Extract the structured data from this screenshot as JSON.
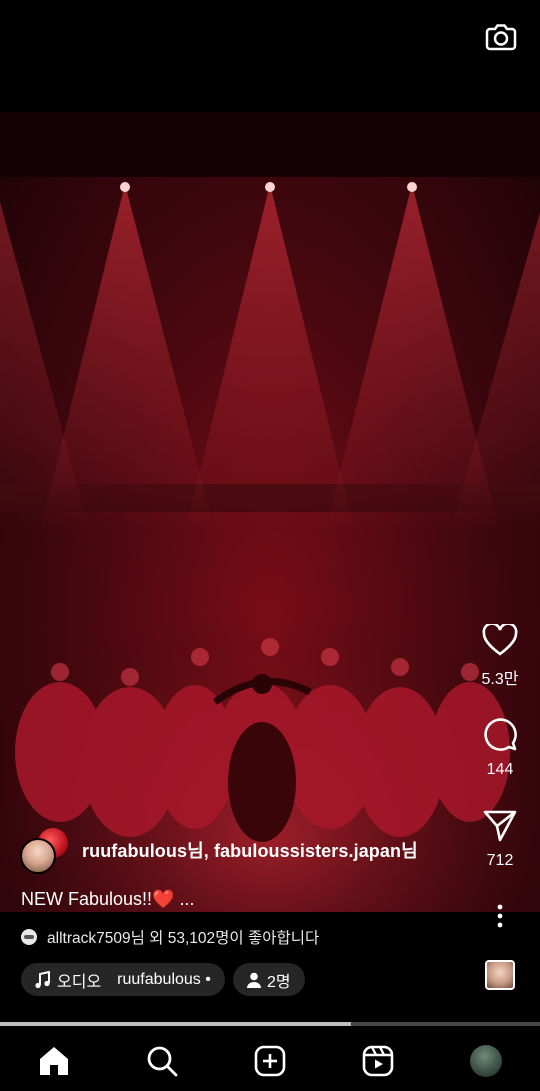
{
  "post": {
    "author_names": "ruufabulous님, fabuloussisters.japan님",
    "caption": "NEW Fabulous!!❤️ ...",
    "likes_text": "alltrack7509님 외 53,102명이 좋아합니다",
    "audio_label": "오디오",
    "audio_author": "ruufabulous •",
    "people_label": "2명"
  },
  "actions": {
    "like_count": "5.3만",
    "comment_count": "144",
    "share_count": "712"
  },
  "video": {
    "progress_fraction": 0.65
  },
  "icons": {
    "camera": "camera-icon",
    "like": "heart-icon",
    "comment": "comment-icon",
    "share": "send-icon",
    "more": "more-vertical-icon",
    "music": "music-note-icon",
    "person": "person-icon",
    "home": "home-icon",
    "search": "search-icon",
    "create": "plus-square-icon",
    "reels": "reels-icon",
    "profile": "profile-avatar"
  },
  "colors": {
    "stage_red": "#8a0f1a",
    "background": "#000000",
    "chip_bg": "#262626",
    "heart": "#e0212f"
  }
}
